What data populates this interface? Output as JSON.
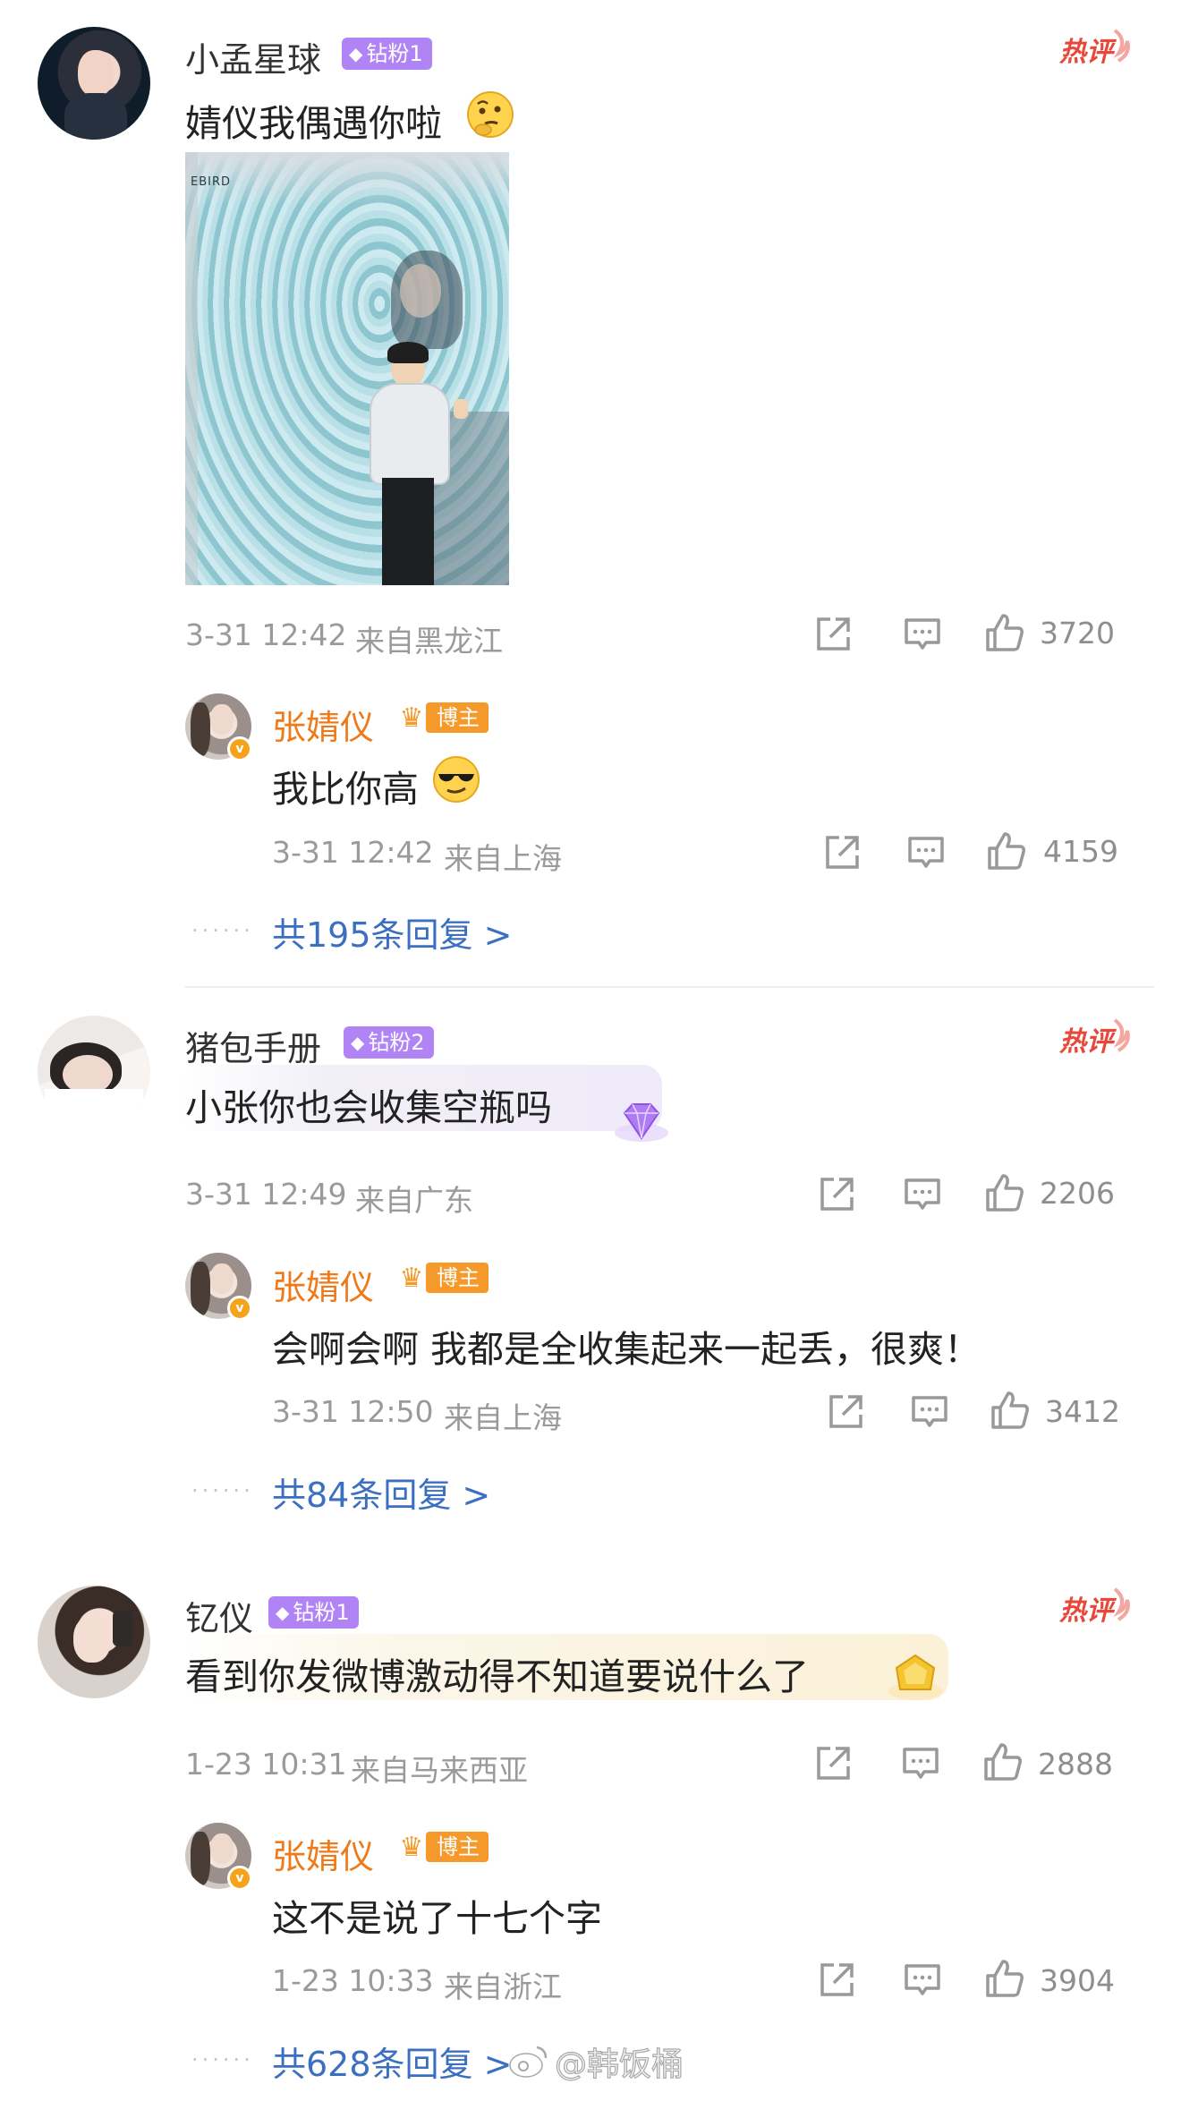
{
  "comments": [
    {
      "user": "小孟星球",
      "badge": "钻粉1",
      "hot_label": "热评",
      "text": "婧仪我偶遇你啦",
      "time": "3-31 12:42",
      "location": "来自黑龙江",
      "likes": "3720",
      "reply": {
        "user": "张婧仪",
        "badge": "博主",
        "text": "我比你高",
        "time": "3-31 12:42",
        "location": "来自上海",
        "likes": "4159"
      },
      "more_replies": "共195条回复 >"
    },
    {
      "user": "猪包手册",
      "badge": "钻粉2",
      "hot_label": "热评",
      "text": "小张你也会收集空瓶吗",
      "time": "3-31 12:49",
      "location": "来自广东",
      "likes": "2206",
      "reply": {
        "user": "张婧仪",
        "badge": "博主",
        "text": "会啊会啊 我都是全收集起来一起丢，很爽！",
        "time": "3-31 12:50",
        "location": "来自上海",
        "likes": "3412"
      },
      "more_replies": "共84条回复 >"
    },
    {
      "user": "钇仪",
      "badge": "钻粉1",
      "hot_label": "热评",
      "text": "看到你发微博激动得不知道要说什么了",
      "time": "1-23 10:31",
      "location": "来自马来西亚",
      "likes": "2888",
      "reply": {
        "user": "张婧仪",
        "badge": "博主",
        "text": "这不是说了十七个字",
        "time": "1-23 10:33",
        "location": "来自浙江",
        "likes": "3904"
      },
      "more_replies": "共628条回复 >"
    }
  ],
  "watermark": "@韩饭桶",
  "dots": "······",
  "icons": [
    "share-icon",
    "comment-icon",
    "like-icon",
    "hot-comment-icon",
    "diamond-icon",
    "crown-icon",
    "verified-badge-icon",
    "emoji-thinking-icon",
    "emoji-sunglasses-icon",
    "weibo-logo-icon"
  ],
  "colors": {
    "owner_name": "#ef7a1a",
    "fan_badge": "#b184f5",
    "owner_badge": "#f59a2a",
    "link": "#3b6fbf",
    "hot": "#e8483a",
    "meta": "#9a9a9a"
  }
}
